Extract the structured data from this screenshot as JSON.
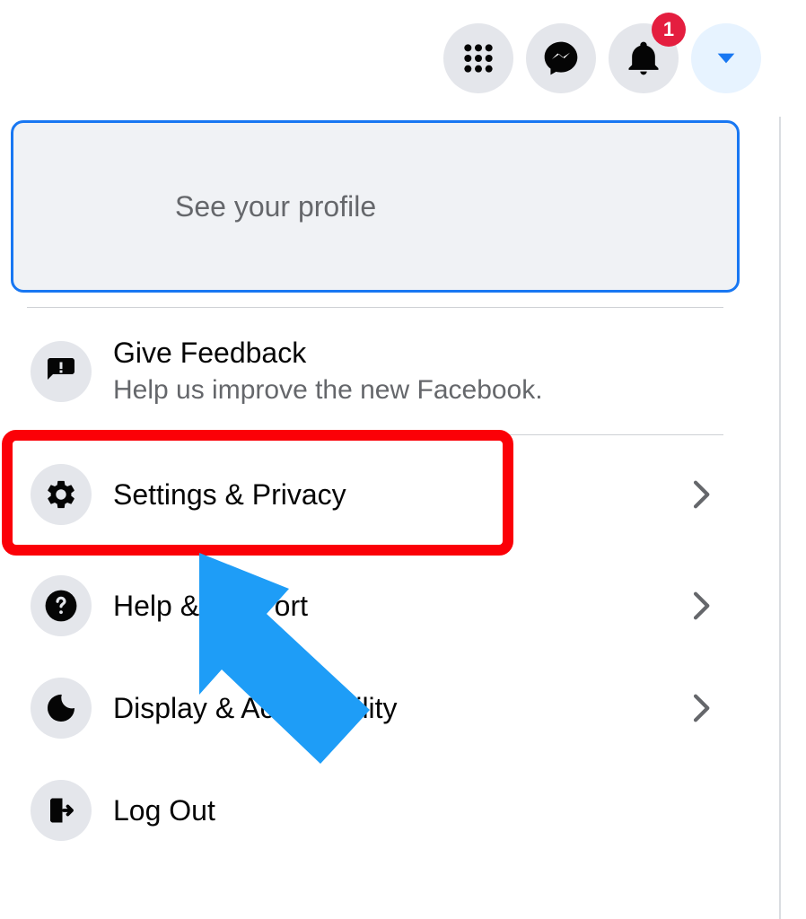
{
  "header": {
    "notification_count": "1"
  },
  "profile": {
    "subtitle": "See your profile"
  },
  "feedback": {
    "title": "Give Feedback",
    "subtitle": "Help us improve the new Facebook."
  },
  "menu": {
    "settings": "Settings & Privacy",
    "help_left": "Help & S",
    "help_right": "ort",
    "display": "Display & Accessibility",
    "logout": "Log Out"
  },
  "annotations": {
    "highlight_target": "settings-privacy"
  }
}
